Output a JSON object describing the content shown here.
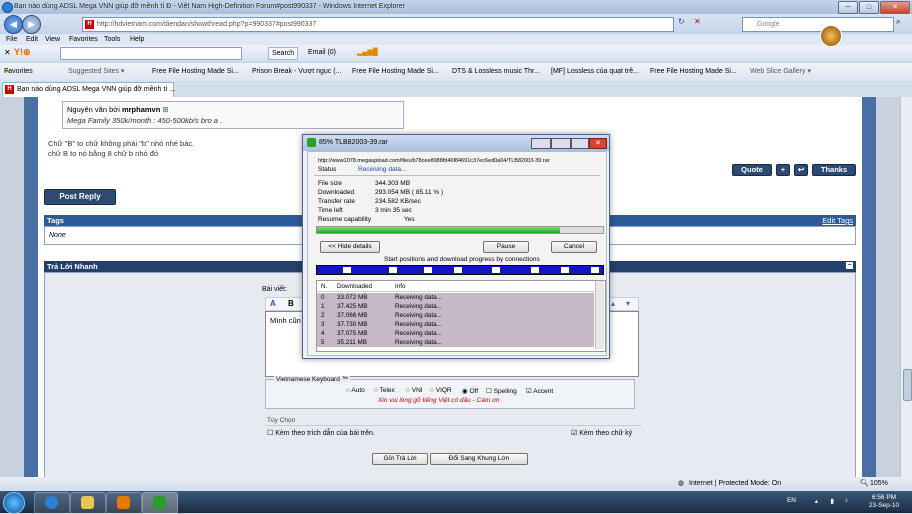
{
  "browser": {
    "title": "Bạn nào dùng ADSL Mega VNN giúp đỡ mềnh tí Đ - Việt Nam High-Definition Forum#post990337 - Windows Internet Explorer",
    "url": "http://hdvietnam.com/diendan/showthread.php?p=990337#post990337",
    "search_placeholder": "Google",
    "menu": [
      "File",
      "Edit",
      "View",
      "Favorites",
      "Tools",
      "Help"
    ],
    "toolbar": {
      "search_label": "Search",
      "email_label": "Email (0)"
    },
    "favorites_label": "Favorites",
    "favorites": [
      "Suggested Sites ▾",
      "Free File Hosting Made Si...",
      "Prison Break - Vượt ngục (...",
      "Free File Hosting Made Si...",
      "DTS & Lossless music Thr...",
      "[MF] Lossless của quạt trê...",
      "Free File Hosting Made Si...",
      "Web Slice Gallery ▾"
    ],
    "tab_title": "Bạn nào dùng ADSL Mega VNN giúp đỡ mềnh tí ..."
  },
  "forum": {
    "quote_author_prefix": "Nguyên văn bởi",
    "quote_author": "mrphamvn",
    "quote_text": "Mega Family 350k/month : 450-500kb/s bro a .",
    "post_lines": [
      "Chữ \"B\" to chữ không phải \"b\" nhỏ nhé bác.",
      "chữ B to nó bằng 8 chữ b nhỏ đó"
    ],
    "quote_button": "Quote",
    "thanks_button": "Thanks",
    "post_reply_button": "Post Reply",
    "tags_header": "Tags",
    "edit_tags": "Edit Tags",
    "tags_value": "None",
    "quick_reply_header": "Trả Lời Nhanh",
    "message_label": "Bài viết:",
    "editor_text": "Mình cũn",
    "keyboard_label": "Vietnamese Keyboard ™",
    "keyboard_options": [
      "Auto",
      "Telex",
      "VNI",
      "VIQR",
      "Off",
      "Spelling",
      "Accent"
    ],
    "keyboard_note": "Xin vui lòng gõ tiếng Việt có dấu  -  Cám ơn",
    "options_label": "Tùy Chọn",
    "quote_option": "Kèm theo trích dẫn của bài trên.",
    "signature_option": "Kèm theo chữ ký",
    "submit_button": "Gởi Trả Lời",
    "advanced_button": "Đổi Sang Khung Lớn"
  },
  "download_dialog": {
    "title": "85% TLB82003-39.rar",
    "url": "http://www1078.megaupload.com/files/b78cee8988fd46f84691c37ec6ed0a04/TLB82003-39.rar",
    "status_label": "Status",
    "status_value": "Receiving data...",
    "fields": [
      {
        "k": "File size",
        "v": "344.303  MB"
      },
      {
        "k": "Downloaded",
        "v": "293.054  MB  ( 85.11 % )"
      },
      {
        "k": "Transfer rate",
        "v": "234.582  KB/sec"
      },
      {
        "k": "Time left",
        "v": "3 min 35 sec"
      },
      {
        "k": "Resume capability",
        "v": "Yes"
      }
    ],
    "progress": 0.85,
    "hide_details": "<< Hide details",
    "pause": "Pause",
    "cancel": "Cancel",
    "connections_caption": "Start positions and download progress by connections",
    "table_headers": [
      "N.",
      "Downloaded",
      "Info"
    ],
    "rows": [
      {
        "n": "0",
        "d": "33.072  MB",
        "i": "Receiving data..."
      },
      {
        "n": "1",
        "d": "37.425  MB",
        "i": "Receiving data..."
      },
      {
        "n": "2",
        "d": "37.066  MB",
        "i": "Receiving data..."
      },
      {
        "n": "3",
        "d": "37.730  MB",
        "i": "Receiving data..."
      },
      {
        "n": "4",
        "d": "37.075  MB",
        "i": "Receiving data..."
      },
      {
        "n": "5",
        "d": "35.211  MB",
        "i": "Receiving data..."
      }
    ]
  },
  "statusbar": {
    "text": "Internet | Protected Mode: On",
    "zoom": "105%"
  },
  "taskbar": {
    "lang": "EN",
    "time": "6:56 PM",
    "date": "23-Sep-10"
  }
}
